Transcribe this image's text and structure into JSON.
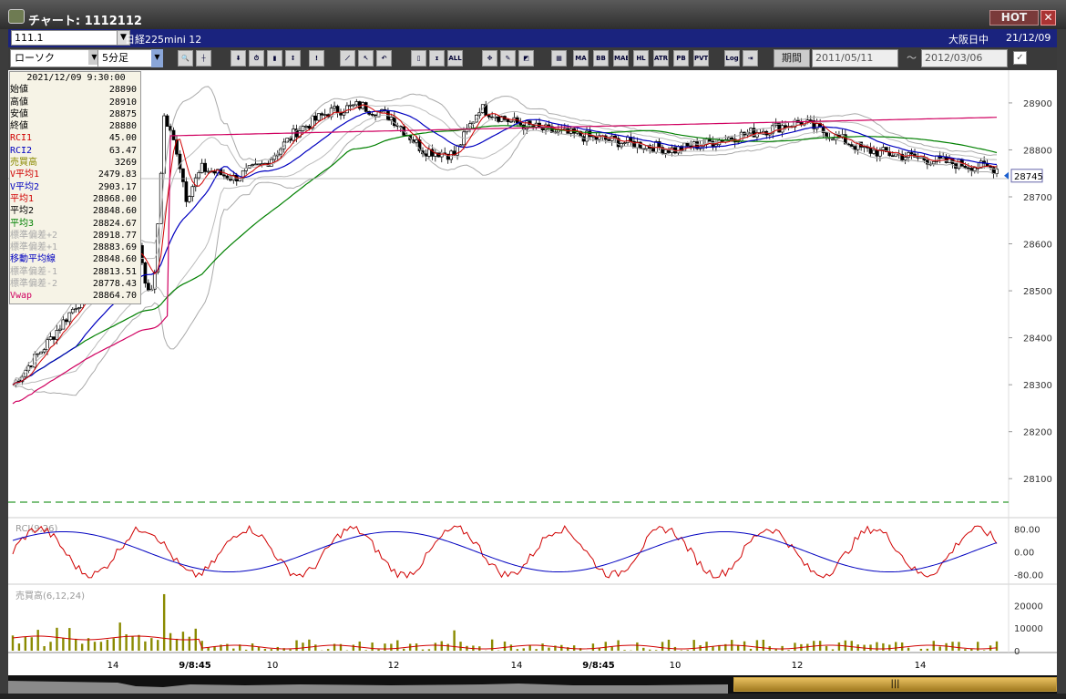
{
  "window": {
    "title": "チャート: 1112112",
    "hot_label": "HOT",
    "close_label": "✕"
  },
  "symbol_bar": {
    "code": "111.1",
    "name": "日経225mini 12",
    "market": "大阪日中",
    "date": "21/12/09"
  },
  "toolbar": {
    "chart_type": "ローソク",
    "period": "5分足",
    "period_button": "期間",
    "date_from": "2011/05/11",
    "date_to": "2012/03/06",
    "tilde": "〜",
    "icons": [
      "zoom-icon",
      "crosshair-icon",
      "arrow-down-icon",
      "search-time-icon",
      "bar-chart-icon",
      "buy-sell-icon",
      "info-icon",
      "draw-line-icon",
      "cursor-icon",
      "undo-icon",
      "candle-icon",
      "ohlc-icon",
      "all-icon",
      "settings-icon",
      "pen-icon",
      "color-icon",
      "grid-icon",
      "ma-icon",
      "bb-icon",
      "mae-icon",
      "hl-icon",
      "atr-icon",
      "pb-icon",
      "pvt-icon",
      "log-icon",
      "export-icon"
    ],
    "icon_labels": [
      "🔍",
      "┼",
      "⬇",
      "⏱",
      "▮",
      "↕",
      "!",
      "⟋",
      "↖",
      "↶",
      "▯",
      "ɪ",
      "ALL",
      "✥",
      "✎",
      "◩",
      "▦",
      "MA",
      "BB",
      "MAE",
      "HL",
      "ATR",
      "PB",
      "PVT",
      "Log",
      "⇥"
    ]
  },
  "info_panel": {
    "datetime": "2021/12/09  9:30:00",
    "rows": [
      {
        "label": "始値",
        "value": "28890",
        "color": "#000"
      },
      {
        "label": "高値",
        "value": "28910",
        "color": "#000"
      },
      {
        "label": "安値",
        "value": "28875",
        "color": "#000"
      },
      {
        "label": "終値",
        "value": "28880",
        "color": "#000"
      },
      {
        "label": "RCI1",
        "value": "45.00",
        "color": "#d00000"
      },
      {
        "label": "RCI2",
        "value": "63.47",
        "color": "#0000c0"
      },
      {
        "label": "売買高",
        "value": "3269",
        "color": "#8a8a00"
      },
      {
        "label": "V平均1",
        "value": "2479.83",
        "color": "#d00000"
      },
      {
        "label": "V平均2",
        "value": "2903.17",
        "color": "#0000c0"
      },
      {
        "label": "平均1",
        "value": "28868.00",
        "color": "#d00000"
      },
      {
        "label": "平均2",
        "value": "28848.60",
        "color": "#000"
      },
      {
        "label": "平均3",
        "value": "28824.67",
        "color": "#008000"
      },
      {
        "label": "標準偏差+2",
        "value": "28918.77",
        "color": "#aaaaaa"
      },
      {
        "label": "標準偏差+1",
        "value": "28883.69",
        "color": "#aaaaaa"
      },
      {
        "label": "移動平均線",
        "value": "28848.60",
        "color": "#0000c0"
      },
      {
        "label": "標準偏差-1",
        "value": "28813.51",
        "color": "#aaaaaa"
      },
      {
        "label": "標準偏差-2",
        "value": "28778.43",
        "color": "#aaaaaa"
      },
      {
        "label": "Vwap",
        "value": "28864.70",
        "color": "#d00060"
      }
    ]
  },
  "chart_data": [
    {
      "type": "candlestick",
      "ylim": [
        28050,
        28960
      ],
      "yticks": [
        28100,
        28200,
        28300,
        28400,
        28500,
        28600,
        28700,
        28800,
        28900
      ],
      "current_price": "28745",
      "xticks": [
        "14",
        "9/8:45",
        "10",
        "12",
        "14",
        "9/8:45",
        "10",
        "12",
        "14"
      ],
      "series": [
        {
          "name": "平均1",
          "color": "#d00000"
        },
        {
          "name": "平均2",
          "color": "#000000"
        },
        {
          "name": "平均3",
          "color": "#008000"
        },
        {
          "name": "移動平均線",
          "color": "#0000c0"
        },
        {
          "name": "Vwap",
          "color": "#d00060"
        }
      ]
    },
    {
      "type": "line",
      "title": "RCI(9,26)",
      "ylim": [
        -100,
        100
      ],
      "yticks": [
        "80.00",
        "0.00",
        "-80.00"
      ],
      "series": [
        {
          "name": "RCI1",
          "color": "#d00000"
        },
        {
          "name": "RCI2",
          "color": "#0000c0"
        }
      ]
    },
    {
      "type": "bar",
      "title": "売買高(6,12,24)",
      "yticks": [
        "20000",
        "10000",
        "0"
      ]
    }
  ],
  "scroll": {
    "thumb_label": "|||"
  }
}
